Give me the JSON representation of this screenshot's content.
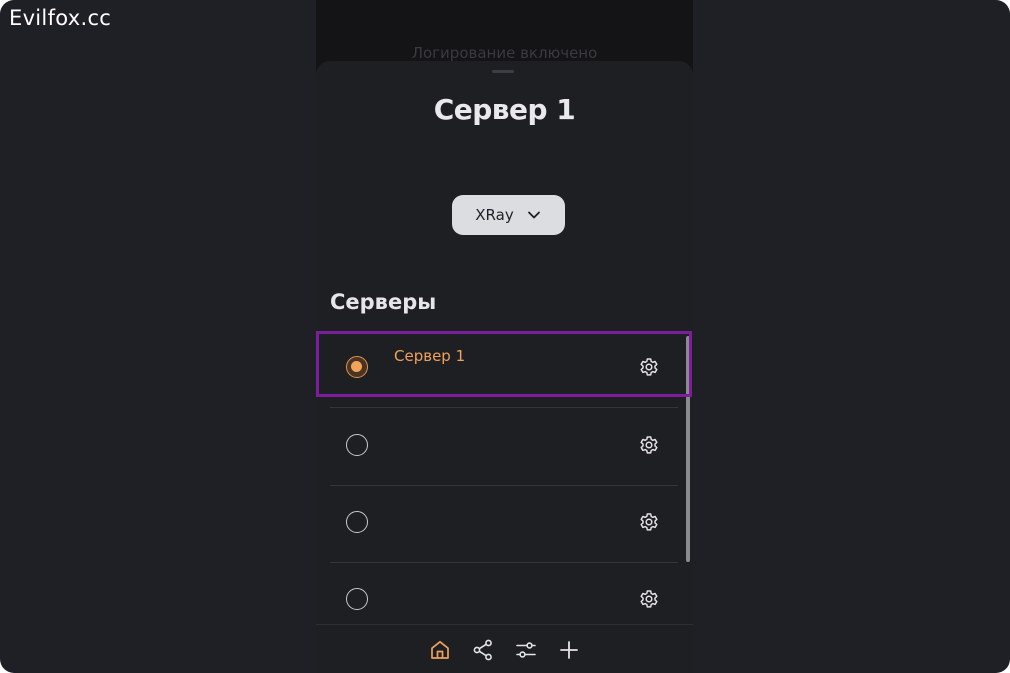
{
  "watermark": "Evilfox.cc",
  "background_status": "Логирование включено",
  "sheet": {
    "title": "Сервер 1",
    "protocol_selector": {
      "value": "XRay",
      "icon": "chevron-down-icon"
    },
    "section_title": "Серверы",
    "servers": [
      {
        "label": "Сервер 1",
        "selected": true
      },
      {
        "label": "",
        "selected": false
      },
      {
        "label": "",
        "selected": false
      },
      {
        "label": "",
        "selected": false
      }
    ]
  },
  "navbar": {
    "items": [
      {
        "icon": "home-icon",
        "active": true
      },
      {
        "icon": "share-icon",
        "active": false
      },
      {
        "icon": "sliders-icon",
        "active": false
      },
      {
        "icon": "plus-icon",
        "active": false
      }
    ]
  },
  "colors": {
    "accent": "#efa25d",
    "highlight": "#7e1d9b",
    "background": "#1f2025",
    "sheet": "#1e1f23"
  }
}
